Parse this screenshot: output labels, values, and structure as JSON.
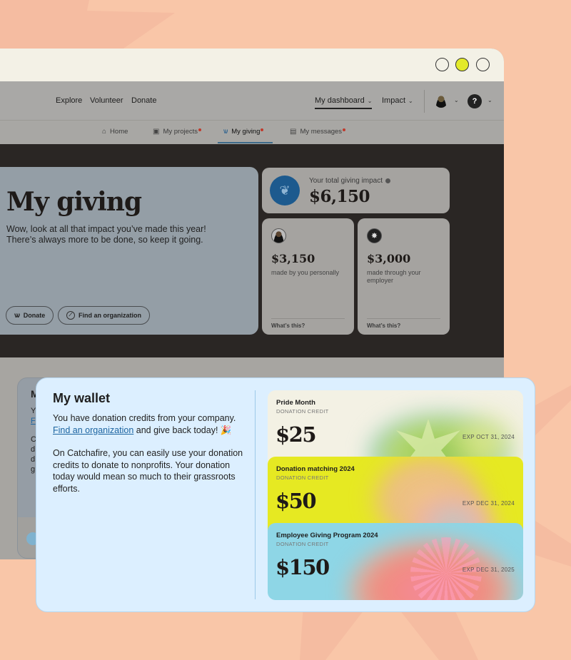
{
  "window": {
    "controls": [
      "minimize",
      "maximize",
      "close"
    ],
    "accent": "#e3ea2a"
  },
  "topnav": {
    "links": [
      "Explore",
      "Volunteer",
      "Donate"
    ],
    "dashboard": "My dashboard",
    "impact": "Impact",
    "chevron": "⌄",
    "help": "?"
  },
  "subnav": {
    "tabs": [
      {
        "label": "Home",
        "icon": "home-icon"
      },
      {
        "label": "My projects",
        "icon": "briefcase-icon",
        "notification": true
      },
      {
        "label": "My giving",
        "icon": "giving-hands-icon",
        "notification": true,
        "active": true
      },
      {
        "label": "My messages",
        "icon": "message-icon",
        "notification": true
      }
    ]
  },
  "hero": {
    "title": "My giving",
    "subtitle": "Wow, look at all that impact you’ve made this year! There’s always more to be done, so keep it going.",
    "donate_button": "Donate",
    "find_org_button": "Find an organization"
  },
  "impact": {
    "label": "Your total giving impact",
    "total": "$6,150",
    "personal_value": "$3,150",
    "personal_desc": "made by you personally",
    "employer_value": "$3,000",
    "employer_desc": "made through your employer",
    "whats_this": "What’s this?"
  },
  "behind_card": {
    "title_fragment": "M",
    "lines": [
      "Y",
      "F",
      "C",
      "d",
      "d",
      "g"
    ]
  },
  "wallet": {
    "title": "My wallet",
    "intro": "You have donation credits from your company.",
    "link": "Find an organization",
    "intro_tail": " and give back today! 🎉",
    "body": "On Catchafire, you can easily use your donation credits to donate to nonprofits. Your donation today would mean so much to their grassroots efforts.",
    "credits": [
      {
        "name": "Pride Month",
        "type": "DONATION CREDIT",
        "amount": "$25",
        "expires": "EXP OCT 31, 2024",
        "color": "#f3f1e4"
      },
      {
        "name": "Donation matching 2024",
        "type": "DONATION CREDIT",
        "amount": "$50",
        "expires": "EXP DEC 31, 2024",
        "color": "#e6e922"
      },
      {
        "name": "Employee Giving Program 2024",
        "type": "DONATION CREDIT",
        "amount": "$150",
        "expires": "EXP DEC 31, 2025",
        "color": "#8ed6e6"
      }
    ]
  }
}
